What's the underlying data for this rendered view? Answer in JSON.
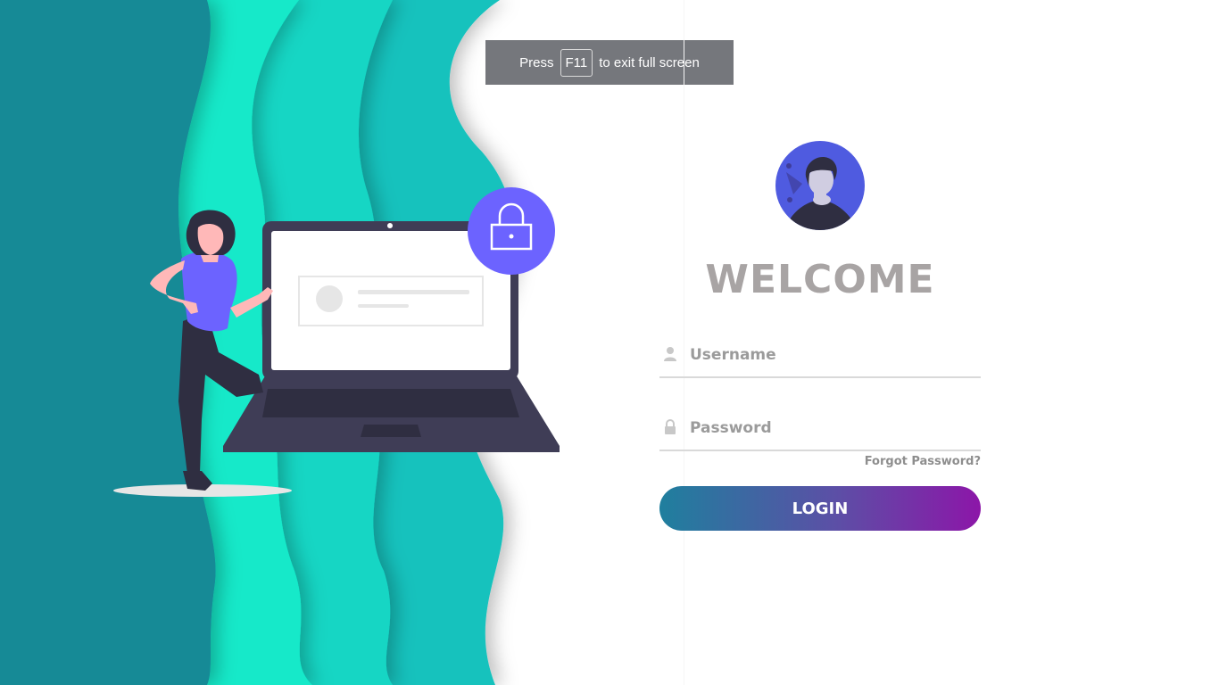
{
  "fullscreen_notice": {
    "press": "Press",
    "key": "F11",
    "suffix": "to exit full screen"
  },
  "login": {
    "title": "WELCOME",
    "username_placeholder": "Username",
    "password_placeholder": "Password",
    "forgot_password": "Forgot Password?",
    "submit_label": "LOGIN"
  },
  "icons": {
    "username": "user-icon",
    "password": "lock-icon",
    "avatar": "avatar-icon",
    "illustration_lock": "padlock-icon"
  },
  "colors": {
    "wave_dark": "#158a96",
    "wave_light": "#12e9c9",
    "wave_mid": "#16c9c0",
    "accent_purple": "#6c63ff",
    "button_start": "#1f7f9e",
    "button_end": "#8c16a8",
    "title_gray": "#a8a4a4"
  }
}
